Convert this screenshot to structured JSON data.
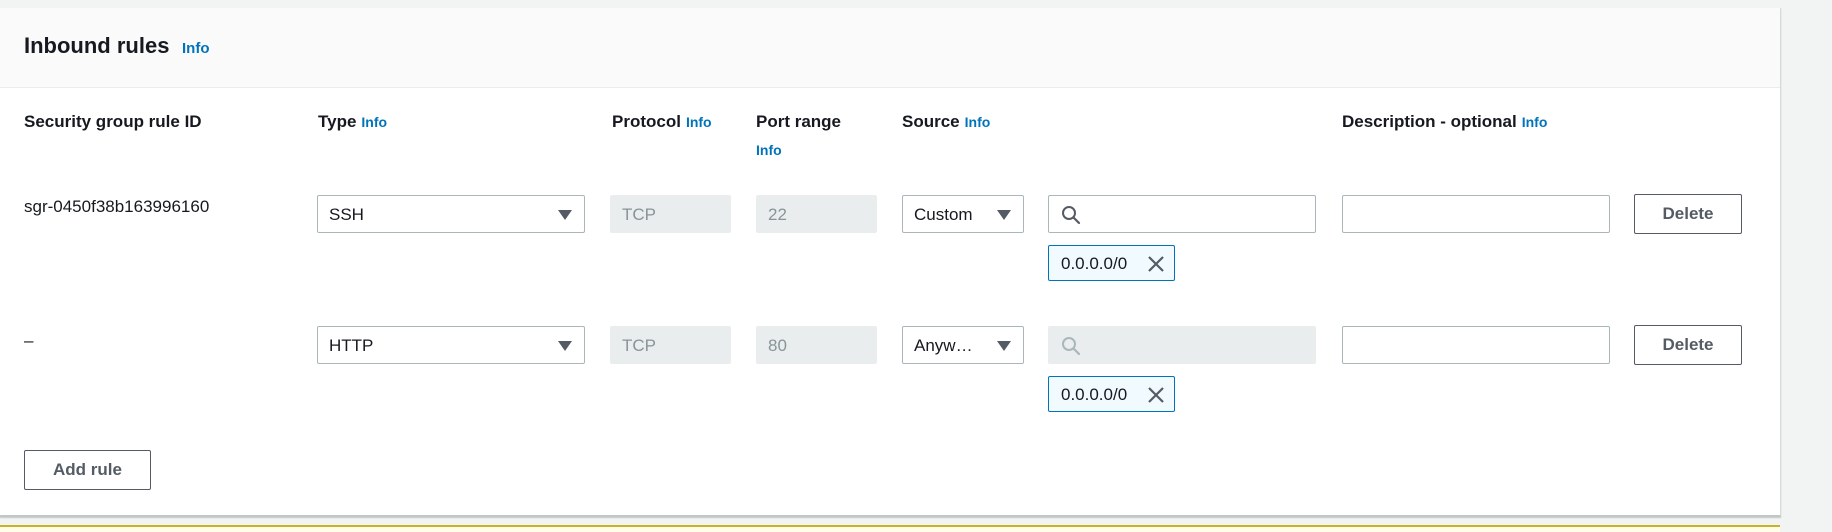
{
  "panel": {
    "title": "Inbound rules",
    "title_info": "Info"
  },
  "columns": {
    "rule_id": "Security group rule ID",
    "type": "Type",
    "type_info": "Info",
    "protocol": "Protocol",
    "protocol_info": "Info",
    "port_range": "Port range",
    "port_range_info": "Info",
    "source": "Source",
    "source_info": "Info",
    "description": "Description - optional",
    "description_info": "Info"
  },
  "rules": [
    {
      "rule_id": "sgr-0450f38b163996160",
      "type": "SSH",
      "protocol": "TCP",
      "port_range": "22",
      "source": "Custom",
      "search_value": "",
      "cidr_token": "0.0.0.0/0",
      "description": "",
      "delete_label": "Delete"
    },
    {
      "rule_id": "–",
      "type": "HTTP",
      "protocol": "TCP",
      "port_range": "80",
      "source": "Anyw…",
      "search_value": "",
      "cidr_token": "0.0.0.0/0",
      "description": "",
      "delete_label": "Delete"
    }
  ],
  "actions": {
    "add_rule": "Add rule"
  },
  "colors": {
    "info_link": "#0073bb",
    "token_border": "#0073bb",
    "disabled_bg": "#eaeded"
  }
}
